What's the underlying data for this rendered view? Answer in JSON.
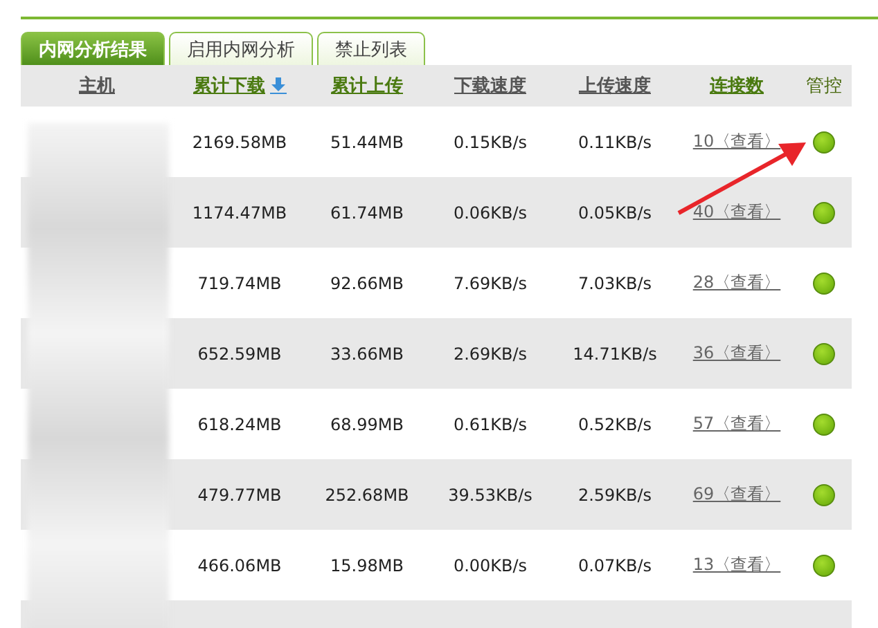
{
  "tabs": [
    {
      "label": "内网分析结果",
      "selected": true
    },
    {
      "label": "启用内网分析",
      "selected": false
    },
    {
      "label": "禁止列表",
      "selected": false
    }
  ],
  "table": {
    "columns": [
      {
        "label": "主机",
        "sorted": false
      },
      {
        "label": "累计下载",
        "sorted": true
      },
      {
        "label": "累计上传",
        "sorted": false
      },
      {
        "label": "下载速度",
        "sorted": false
      },
      {
        "label": "上传速度",
        "sorted": false
      },
      {
        "label": "连接数",
        "sorted": false
      },
      {
        "label": "管控",
        "sorted": false
      }
    ],
    "rows": [
      {
        "download": "2169.58MB",
        "upload": "51.44MB",
        "down_speed": "0.15KB/s",
        "up_speed": "0.11KB/s",
        "connections": "10〈查看〉",
        "control_on": true
      },
      {
        "download": "1174.47MB",
        "upload": "61.74MB",
        "down_speed": "0.06KB/s",
        "up_speed": "0.05KB/s",
        "connections": "40〈查看〉",
        "control_on": true
      },
      {
        "download": "719.74MB",
        "upload": "92.66MB",
        "down_speed": "7.69KB/s",
        "up_speed": "7.03KB/s",
        "connections": "28〈查看〉",
        "control_on": true
      },
      {
        "download": "652.59MB",
        "upload": "33.66MB",
        "down_speed": "2.69KB/s",
        "up_speed": "14.71KB/s",
        "connections": "36〈查看〉",
        "control_on": true
      },
      {
        "download": "618.24MB",
        "upload": "68.99MB",
        "down_speed": "0.61KB/s",
        "up_speed": "0.52KB/s",
        "connections": "57〈查看〉",
        "control_on": true
      },
      {
        "download": "479.77MB",
        "upload": "252.68MB",
        "down_speed": "39.53KB/s",
        "up_speed": "2.59KB/s",
        "connections": "69〈查看〉",
        "control_on": true
      },
      {
        "download": "466.06MB",
        "upload": "15.98MB",
        "down_speed": "0.00KB/s",
        "up_speed": "0.07KB/s",
        "connections": "13〈查看〉",
        "control_on": true
      }
    ]
  }
}
